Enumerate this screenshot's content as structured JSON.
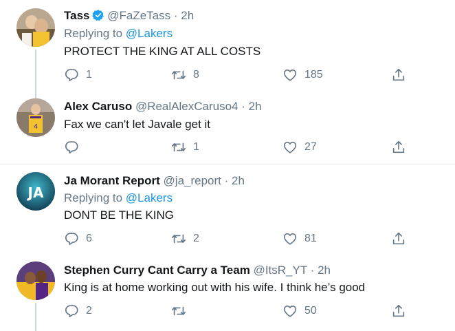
{
  "tweets": [
    {
      "name": "Tass",
      "verified": true,
      "handle": "@FaZeTass",
      "dot": "·",
      "time": "2h",
      "replying_prefix": "Replying to",
      "replying_to": "@Lakers",
      "text": "PROTECT THE KING AT ALL COSTS",
      "reply_count": "1",
      "retweet_count": "8",
      "like_count": "185"
    },
    {
      "name": "Alex Caruso",
      "handle": "@RealAlexCaruso4",
      "dot": "·",
      "time": "2h",
      "text": "Fax we can't let Javale get it",
      "reply_count": "",
      "retweet_count": "1",
      "like_count": "27"
    },
    {
      "name": "Ja Morant Report",
      "handle": "@ja_report",
      "dot": "·",
      "time": "2h",
      "replying_prefix": "Replying to",
      "replying_to": "@Lakers",
      "text": "DONT BE THE KING",
      "reply_count": "6",
      "retweet_count": "2",
      "like_count": "81",
      "avatar_text": "JA"
    },
    {
      "name": "Stephen Curry Cant Carry a Team",
      "handle": "@ItsR_YT",
      "dot": "·",
      "time": "2h",
      "text": "King is at home working out with his wife. I think he’s good",
      "reply_count": "2",
      "retweet_count": "",
      "like_count": "50"
    }
  ],
  "colors": {
    "text": "#14171a",
    "secondary": "#657786",
    "link": "#1b95e0",
    "verified": "#1da1f2",
    "thread_line": "#ccd6dd",
    "divider": "#e6ecf0"
  },
  "icons": [
    "reply-icon",
    "retweet-icon",
    "like-icon",
    "share-icon",
    "verified-badge-icon"
  ]
}
